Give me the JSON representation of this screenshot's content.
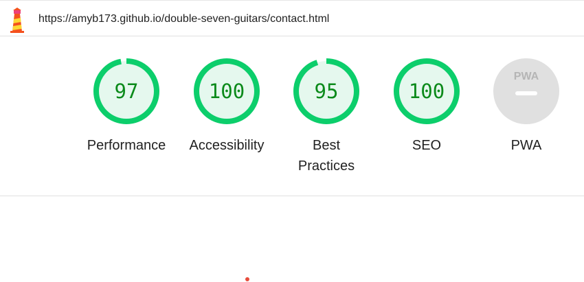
{
  "report": {
    "url": "https://amyb173.github.io/double-seven-guitars/contact.html"
  },
  "categories": [
    {
      "label": "Performance",
      "score": "97",
      "fraction": 0.97
    },
    {
      "label": "Accessibility",
      "score": "100",
      "fraction": 1.0
    },
    {
      "label": "Best Practices",
      "score": "95",
      "fraction": 0.95
    },
    {
      "label": "SEO",
      "score": "100",
      "fraction": 1.0
    },
    {
      "label": "PWA",
      "score": "",
      "badge_text": "PWA"
    }
  ],
  "colors": {
    "pass": "#0cce6b",
    "pass_fill": "#e5f8ee",
    "pass_text": "#0b8a1a",
    "pwa_bg": "#e0e0e0",
    "pwa_mark": "#ffffff"
  },
  "icons": {
    "lighthouse": "lighthouse-logo-icon",
    "pwa": "pwa-badge-icon"
  }
}
